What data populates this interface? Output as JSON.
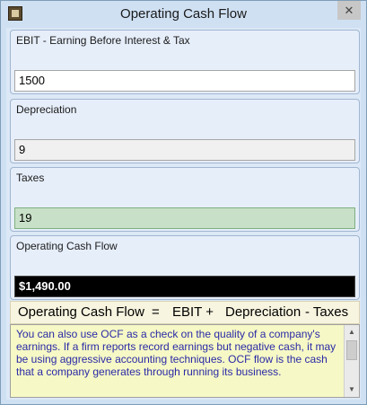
{
  "window": {
    "title": "Operating Cash Flow",
    "close_glyph": "✕",
    "icon": "app-icon"
  },
  "ebit": {
    "label": "EBIT - Earning Before Interest & Tax",
    "value": "1500"
  },
  "depreciation": {
    "label": "Depreciation",
    "value": "9"
  },
  "taxes": {
    "label": "Taxes",
    "value": "19"
  },
  "ocf": {
    "label": "Operating Cash Flow",
    "value": "$1,490.00"
  },
  "formula": {
    "term1": "Operating Cash Flow",
    "eq": "=",
    "term2": "EBIT +",
    "term3": "Depreciation",
    "term4": "- Taxes"
  },
  "note": {
    "text": "You can also use OCF as a check on the quality of a company's earnings. If a firm reports record earnings but negative cash, it may be using aggressive accounting techniques. OCF flow is the cash that a company generates through running its business."
  },
  "colors": {
    "window_bg": "#cfe0f3",
    "note_bg": "#f6f8c6",
    "note_text": "#2a2aa6",
    "result_bg": "#000000",
    "focused_field_bg": "#c8e0c8"
  }
}
